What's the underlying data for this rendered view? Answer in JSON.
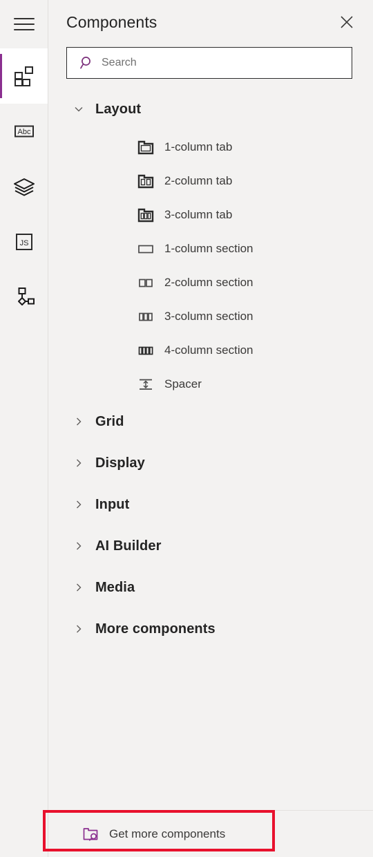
{
  "rail": {
    "menu": {
      "name": "hamburger-menu",
      "label": "Menu"
    },
    "items": [
      {
        "name": "components",
        "label": "Components",
        "icon": "components-icon",
        "active": true
      },
      {
        "name": "text-properties",
        "label": "Abc",
        "icon": "abc-icon",
        "active": false
      },
      {
        "name": "layers",
        "label": "Layers",
        "icon": "layers-icon",
        "active": false
      },
      {
        "name": "code",
        "label": "JS",
        "icon": "js-icon",
        "active": false
      },
      {
        "name": "flow",
        "label": "Flow",
        "icon": "flow-icon",
        "active": false
      }
    ]
  },
  "header": {
    "title": "Components",
    "close_label": "Close"
  },
  "search": {
    "placeholder": "Search",
    "value": "",
    "icon": "search-icon"
  },
  "tree": {
    "groups": [
      {
        "label": "Layout",
        "expanded": true,
        "items": [
          {
            "label": "1-column tab",
            "icon": "tab-1-column-icon"
          },
          {
            "label": "2-column tab",
            "icon": "tab-2-column-icon"
          },
          {
            "label": "3-column tab",
            "icon": "tab-3-column-icon"
          },
          {
            "label": "1-column section",
            "icon": "section-1-column-icon"
          },
          {
            "label": "2-column section",
            "icon": "section-2-column-icon"
          },
          {
            "label": "3-column section",
            "icon": "section-3-column-icon"
          },
          {
            "label": "4-column section",
            "icon": "section-4-column-icon"
          },
          {
            "label": "Spacer",
            "icon": "spacer-icon"
          }
        ]
      },
      {
        "label": "Grid",
        "expanded": false,
        "items": []
      },
      {
        "label": "Display",
        "expanded": false,
        "items": []
      },
      {
        "label": "Input",
        "expanded": false,
        "items": []
      },
      {
        "label": "AI Builder",
        "expanded": false,
        "items": []
      },
      {
        "label": "Media",
        "expanded": false,
        "items": []
      },
      {
        "label": "More components",
        "expanded": false,
        "items": []
      }
    ]
  },
  "footer": {
    "get_more_label": "Get more components",
    "icon": "folder-search-icon",
    "highlighted": true
  },
  "colors": {
    "accent_purple": "#8a2f8f",
    "panel_background": "#f3f2f1",
    "active_background": "#ffffff",
    "text_primary": "#242424",
    "text_secondary": "#3b3a39",
    "placeholder": "#6f6f6f",
    "border": "#e1dfdd",
    "highlight_red": "#e8112d"
  }
}
